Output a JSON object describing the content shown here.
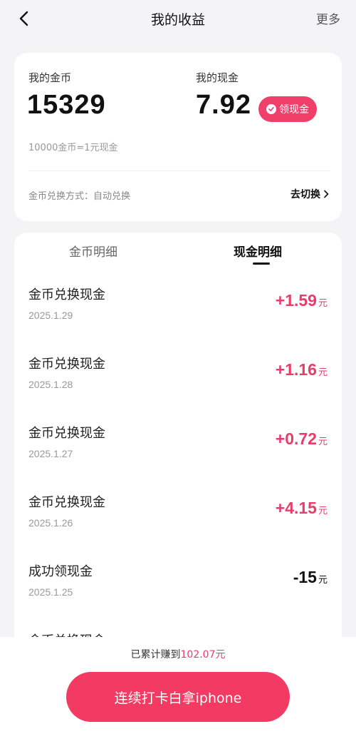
{
  "header": {
    "title": "我的收益",
    "more_label": "更多",
    "back_icon": "chevron-left-icon"
  },
  "summary": {
    "coin_label": "我的金币",
    "coin_value": "15329",
    "cash_label": "我的现金",
    "cash_value": "7.92",
    "withdraw_label": "领现金",
    "rate_text": "10000金币=1元现金",
    "mode_text": "金币兑换方式：自动兑换",
    "switch_label": "去切换",
    "accent_color": "#ef3f6a"
  },
  "tabs": [
    {
      "label": "金币明细",
      "active": false
    },
    {
      "label": "现金明细",
      "active": true
    }
  ],
  "transactions": [
    {
      "title": "金币兑换现金",
      "date": "2025.1.29",
      "amount": "+1.59",
      "unit": "元"
    },
    {
      "title": "金币兑换现金",
      "date": "2025.1.28",
      "amount": "+1.16",
      "unit": "元"
    },
    {
      "title": "金币兑换现金",
      "date": "2025.1.27",
      "amount": "+0.72",
      "unit": "元"
    },
    {
      "title": "金币兑换现金",
      "date": "2025.1.26",
      "amount": "+4.15",
      "unit": "元"
    },
    {
      "title": "成功领现金",
      "date": "2025.1.25",
      "amount": "-15",
      "unit": "元"
    },
    {
      "title": "金币兑换现金",
      "date": "",
      "amount": "",
      "unit": ""
    }
  ],
  "footer": {
    "total_prefix": "已累计赚到",
    "total_value": "102.07元",
    "cta_label": "连续打卡白拿iphone"
  }
}
